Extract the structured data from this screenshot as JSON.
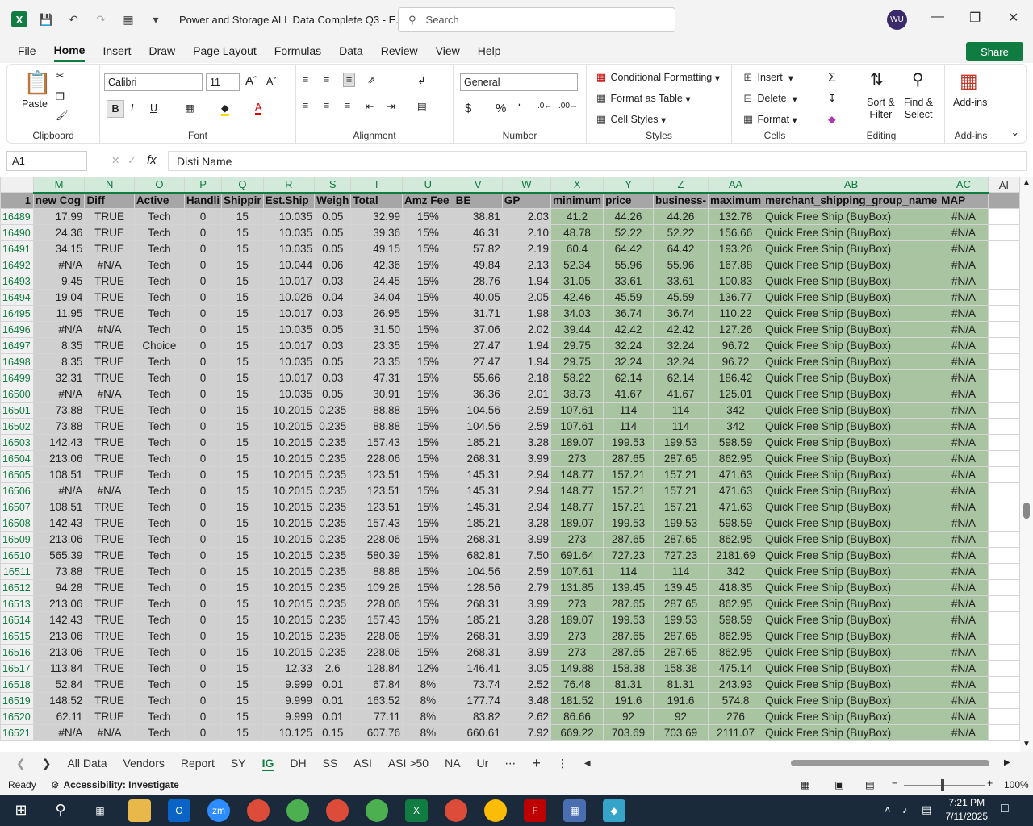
{
  "title_bar": {
    "doc_title": "Power and Storage ALL Data Complete Q3 - E...",
    "search_placeholder": "Search",
    "avatar": "WU"
  },
  "menu": {
    "items": [
      "File",
      "Home",
      "Insert",
      "Draw",
      "Page Layout",
      "Formulas",
      "Data",
      "Review",
      "View",
      "Help"
    ],
    "share": "Share"
  },
  "ribbon": {
    "clipboard": {
      "paste": "Paste",
      "label": "Clipboard"
    },
    "font": {
      "name": "Calibri",
      "size": "11",
      "label": "Font"
    },
    "alignment": {
      "label": "Alignment"
    },
    "number": {
      "format": "General",
      "label": "Number"
    },
    "styles": {
      "conditional": "Conditional Formatting",
      "table": "Format as Table",
      "cell": "Cell Styles",
      "label": "Styles"
    },
    "cells": {
      "insert": "Insert",
      "delete": "Delete",
      "format": "Format",
      "label": "Cells"
    },
    "editing": {
      "sort": "Sort &",
      "filter": "Filter",
      "find": "Find &",
      "select": "Select",
      "label": "Editing"
    },
    "addins": {
      "label": "Add-ins",
      "label2": "Add-ins"
    }
  },
  "formula_bar": {
    "name_box": "A1",
    "value": "Disti Name"
  },
  "columns": [
    "M",
    "N",
    "O",
    "P",
    "Q",
    "R",
    "S",
    "T",
    "U",
    "V",
    "W",
    "X",
    "Y",
    "Z",
    "AA",
    "AB",
    "AC",
    "AI"
  ],
  "header_row": {
    "num": "1",
    "cells": [
      "new Cog",
      "Diff",
      "Active",
      "Handli",
      "Shippir",
      "Est.Ship",
      "Weigh",
      "Total",
      "Amz Fee",
      "BE",
      "GP",
      "minimum",
      "price",
      "business-",
      "maximum",
      "merchant_shipping_group_name",
      "MAP"
    ]
  },
  "rows": [
    [
      "16489",
      "17.99",
      "TRUE",
      "Tech",
      "0",
      "15",
      "10.035",
      "0.05",
      "32.99",
      "15%",
      "38.81",
      "2.03",
      "41.2",
      "44.26",
      "44.26",
      "132.78",
      "Quick Free Ship (BuyBox)",
      "#N/A"
    ],
    [
      "16490",
      "24.36",
      "TRUE",
      "Tech",
      "0",
      "15",
      "10.035",
      "0.05",
      "39.36",
      "15%",
      "46.31",
      "2.10",
      "48.78",
      "52.22",
      "52.22",
      "156.66",
      "Quick Free Ship (BuyBox)",
      "#N/A"
    ],
    [
      "16491",
      "34.15",
      "TRUE",
      "Tech",
      "0",
      "15",
      "10.035",
      "0.05",
      "49.15",
      "15%",
      "57.82",
      "2.19",
      "60.4",
      "64.42",
      "64.42",
      "193.26",
      "Quick Free Ship (BuyBox)",
      "#N/A"
    ],
    [
      "16492",
      "#N/A",
      "#N/A",
      "Tech",
      "0",
      "15",
      "10.044",
      "0.06",
      "42.36",
      "15%",
      "49.84",
      "2.13",
      "52.34",
      "55.96",
      "55.96",
      "167.88",
      "Quick Free Ship (BuyBox)",
      "#N/A"
    ],
    [
      "16493",
      "9.45",
      "TRUE",
      "Tech",
      "0",
      "15",
      "10.017",
      "0.03",
      "24.45",
      "15%",
      "28.76",
      "1.94",
      "31.05",
      "33.61",
      "33.61",
      "100.83",
      "Quick Free Ship (BuyBox)",
      "#N/A"
    ],
    [
      "16494",
      "19.04",
      "TRUE",
      "Tech",
      "0",
      "15",
      "10.026",
      "0.04",
      "34.04",
      "15%",
      "40.05",
      "2.05",
      "42.46",
      "45.59",
      "45.59",
      "136.77",
      "Quick Free Ship (BuyBox)",
      "#N/A"
    ],
    [
      "16495",
      "11.95",
      "TRUE",
      "Tech",
      "0",
      "15",
      "10.017",
      "0.03",
      "26.95",
      "15%",
      "31.71",
      "1.98",
      "34.03",
      "36.74",
      "36.74",
      "110.22",
      "Quick Free Ship (BuyBox)",
      "#N/A"
    ],
    [
      "16496",
      "#N/A",
      "#N/A",
      "Tech",
      "0",
      "15",
      "10.035",
      "0.05",
      "31.50",
      "15%",
      "37.06",
      "2.02",
      "39.44",
      "42.42",
      "42.42",
      "127.26",
      "Quick Free Ship (BuyBox)",
      "#N/A"
    ],
    [
      "16497",
      "8.35",
      "TRUE",
      "Choice",
      "0",
      "15",
      "10.017",
      "0.03",
      "23.35",
      "15%",
      "27.47",
      "1.94",
      "29.75",
      "32.24",
      "32.24",
      "96.72",
      "Quick Free Ship (BuyBox)",
      "#N/A"
    ],
    [
      "16498",
      "8.35",
      "TRUE",
      "Tech",
      "0",
      "15",
      "10.035",
      "0.05",
      "23.35",
      "15%",
      "27.47",
      "1.94",
      "29.75",
      "32.24",
      "32.24",
      "96.72",
      "Quick Free Ship (BuyBox)",
      "#N/A"
    ],
    [
      "16499",
      "32.31",
      "TRUE",
      "Tech",
      "0",
      "15",
      "10.017",
      "0.03",
      "47.31",
      "15%",
      "55.66",
      "2.18",
      "58.22",
      "62.14",
      "62.14",
      "186.42",
      "Quick Free Ship (BuyBox)",
      "#N/A"
    ],
    [
      "16500",
      "#N/A",
      "#N/A",
      "Tech",
      "0",
      "15",
      "10.035",
      "0.05",
      "30.91",
      "15%",
      "36.36",
      "2.01",
      "38.73",
      "41.67",
      "41.67",
      "125.01",
      "Quick Free Ship (BuyBox)",
      "#N/A"
    ],
    [
      "16501",
      "73.88",
      "TRUE",
      "Tech",
      "0",
      "15",
      "10.2015",
      "0.235",
      "88.88",
      "15%",
      "104.56",
      "2.59",
      "107.61",
      "114",
      "114",
      "342",
      "Quick Free Ship (BuyBox)",
      "#N/A"
    ],
    [
      "16502",
      "73.88",
      "TRUE",
      "Tech",
      "0",
      "15",
      "10.2015",
      "0.235",
      "88.88",
      "15%",
      "104.56",
      "2.59",
      "107.61",
      "114",
      "114",
      "342",
      "Quick Free Ship (BuyBox)",
      "#N/A"
    ],
    [
      "16503",
      "142.43",
      "TRUE",
      "Tech",
      "0",
      "15",
      "10.2015",
      "0.235",
      "157.43",
      "15%",
      "185.21",
      "3.28",
      "189.07",
      "199.53",
      "199.53",
      "598.59",
      "Quick Free Ship (BuyBox)",
      "#N/A"
    ],
    [
      "16504",
      "213.06",
      "TRUE",
      "Tech",
      "0",
      "15",
      "10.2015",
      "0.235",
      "228.06",
      "15%",
      "268.31",
      "3.99",
      "273",
      "287.65",
      "287.65",
      "862.95",
      "Quick Free Ship (BuyBox)",
      "#N/A"
    ],
    [
      "16505",
      "108.51",
      "TRUE",
      "Tech",
      "0",
      "15",
      "10.2015",
      "0.235",
      "123.51",
      "15%",
      "145.31",
      "2.94",
      "148.77",
      "157.21",
      "157.21",
      "471.63",
      "Quick Free Ship (BuyBox)",
      "#N/A"
    ],
    [
      "16506",
      "#N/A",
      "#N/A",
      "Tech",
      "0",
      "15",
      "10.2015",
      "0.235",
      "123.51",
      "15%",
      "145.31",
      "2.94",
      "148.77",
      "157.21",
      "157.21",
      "471.63",
      "Quick Free Ship (BuyBox)",
      "#N/A"
    ],
    [
      "16507",
      "108.51",
      "TRUE",
      "Tech",
      "0",
      "15",
      "10.2015",
      "0.235",
      "123.51",
      "15%",
      "145.31",
      "2.94",
      "148.77",
      "157.21",
      "157.21",
      "471.63",
      "Quick Free Ship (BuyBox)",
      "#N/A"
    ],
    [
      "16508",
      "142.43",
      "TRUE",
      "Tech",
      "0",
      "15",
      "10.2015",
      "0.235",
      "157.43",
      "15%",
      "185.21",
      "3.28",
      "189.07",
      "199.53",
      "199.53",
      "598.59",
      "Quick Free Ship (BuyBox)",
      "#N/A"
    ],
    [
      "16509",
      "213.06",
      "TRUE",
      "Tech",
      "0",
      "15",
      "10.2015",
      "0.235",
      "228.06",
      "15%",
      "268.31",
      "3.99",
      "273",
      "287.65",
      "287.65",
      "862.95",
      "Quick Free Ship (BuyBox)",
      "#N/A"
    ],
    [
      "16510",
      "565.39",
      "TRUE",
      "Tech",
      "0",
      "15",
      "10.2015",
      "0.235",
      "580.39",
      "15%",
      "682.81",
      "7.50",
      "691.64",
      "727.23",
      "727.23",
      "2181.69",
      "Quick Free Ship (BuyBox)",
      "#N/A"
    ],
    [
      "16511",
      "73.88",
      "TRUE",
      "Tech",
      "0",
      "15",
      "10.2015",
      "0.235",
      "88.88",
      "15%",
      "104.56",
      "2.59",
      "107.61",
      "114",
      "114",
      "342",
      "Quick Free Ship (BuyBox)",
      "#N/A"
    ],
    [
      "16512",
      "94.28",
      "TRUE",
      "Tech",
      "0",
      "15",
      "10.2015",
      "0.235",
      "109.28",
      "15%",
      "128.56",
      "2.79",
      "131.85",
      "139.45",
      "139.45",
      "418.35",
      "Quick Free Ship (BuyBox)",
      "#N/A"
    ],
    [
      "16513",
      "213.06",
      "TRUE",
      "Tech",
      "0",
      "15",
      "10.2015",
      "0.235",
      "228.06",
      "15%",
      "268.31",
      "3.99",
      "273",
      "287.65",
      "287.65",
      "862.95",
      "Quick Free Ship (BuyBox)",
      "#N/A"
    ],
    [
      "16514",
      "142.43",
      "TRUE",
      "Tech",
      "0",
      "15",
      "10.2015",
      "0.235",
      "157.43",
      "15%",
      "185.21",
      "3.28",
      "189.07",
      "199.53",
      "199.53",
      "598.59",
      "Quick Free Ship (BuyBox)",
      "#N/A"
    ],
    [
      "16515",
      "213.06",
      "TRUE",
      "Tech",
      "0",
      "15",
      "10.2015",
      "0.235",
      "228.06",
      "15%",
      "268.31",
      "3.99",
      "273",
      "287.65",
      "287.65",
      "862.95",
      "Quick Free Ship (BuyBox)",
      "#N/A"
    ],
    [
      "16516",
      "213.06",
      "TRUE",
      "Tech",
      "0",
      "15",
      "10.2015",
      "0.235",
      "228.06",
      "15%",
      "268.31",
      "3.99",
      "273",
      "287.65",
      "287.65",
      "862.95",
      "Quick Free Ship (BuyBox)",
      "#N/A"
    ],
    [
      "16517",
      "113.84",
      "TRUE",
      "Tech",
      "0",
      "15",
      "12.33",
      "2.6",
      "128.84",
      "12%",
      "146.41",
      "3.05",
      "149.88",
      "158.38",
      "158.38",
      "475.14",
      "Quick Free Ship (BuyBox)",
      "#N/A"
    ],
    [
      "16518",
      "52.84",
      "TRUE",
      "Tech",
      "0",
      "15",
      "9.999",
      "0.01",
      "67.84",
      "8%",
      "73.74",
      "2.52",
      "76.48",
      "81.31",
      "81.31",
      "243.93",
      "Quick Free Ship (BuyBox)",
      "#N/A"
    ],
    [
      "16519",
      "148.52",
      "TRUE",
      "Tech",
      "0",
      "15",
      "9.999",
      "0.01",
      "163.52",
      "8%",
      "177.74",
      "3.48",
      "181.52",
      "191.6",
      "191.6",
      "574.8",
      "Quick Free Ship (BuyBox)",
      "#N/A"
    ],
    [
      "16520",
      "62.11",
      "TRUE",
      "Tech",
      "0",
      "15",
      "9.999",
      "0.01",
      "77.11",
      "8%",
      "83.82",
      "2.62",
      "86.66",
      "92",
      "92",
      "276",
      "Quick Free Ship (BuyBox)",
      "#N/A"
    ],
    [
      "16521",
      "#N/A",
      "#N/A",
      "Tech",
      "0",
      "15",
      "10.125",
      "0.15",
      "607.76",
      "8%",
      "660.61",
      "7.92",
      "669.22",
      "703.69",
      "703.69",
      "2111.07",
      "Quick Free Ship (BuyBox)",
      "#N/A"
    ]
  ],
  "sheet_tabs": [
    "All Data",
    "Vendors",
    "Report",
    "SY",
    "IG",
    "DH",
    "SS",
    "ASI",
    "ASI >50",
    "NA",
    "Ur"
  ],
  "active_tab": "IG",
  "status": {
    "ready": "Ready",
    "accessibility": "Accessibility: Investigate",
    "zoom": "100%"
  },
  "clock": {
    "time": "7:21 PM",
    "date": "7/11/2025"
  },
  "colors": {
    "accent": "#107c41",
    "header_fill": "#a6a6a6",
    "green_fill": "#a9c4a0"
  }
}
